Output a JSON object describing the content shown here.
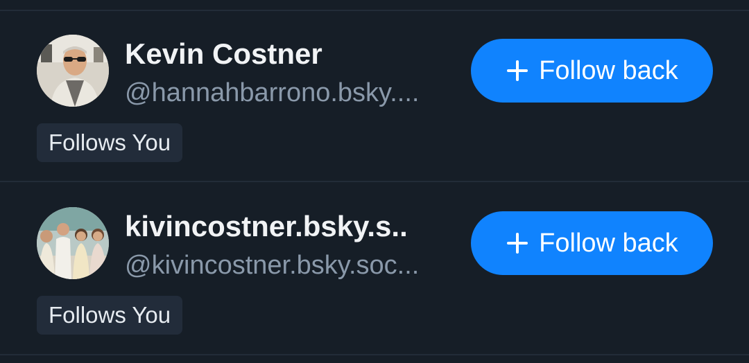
{
  "users": [
    {
      "name": "Kevin Costner",
      "handle": "@hannahbarrono.bsky....",
      "follow_label": "Follow back",
      "badge": "Follows You",
      "avatar_icon": "profile-photo-man-sunglasses"
    },
    {
      "name": "kivincostner.bsky.s..",
      "handle": "@kivincostner.bsky.soc...",
      "follow_label": "Follow back",
      "badge": "Follows You",
      "avatar_icon": "profile-photo-family-group"
    }
  ],
  "colors": {
    "background": "#161e27",
    "divider": "#222c38",
    "accent": "#1083fe",
    "handle_text": "#8a99aa",
    "badge_bg": "#222c3a"
  }
}
